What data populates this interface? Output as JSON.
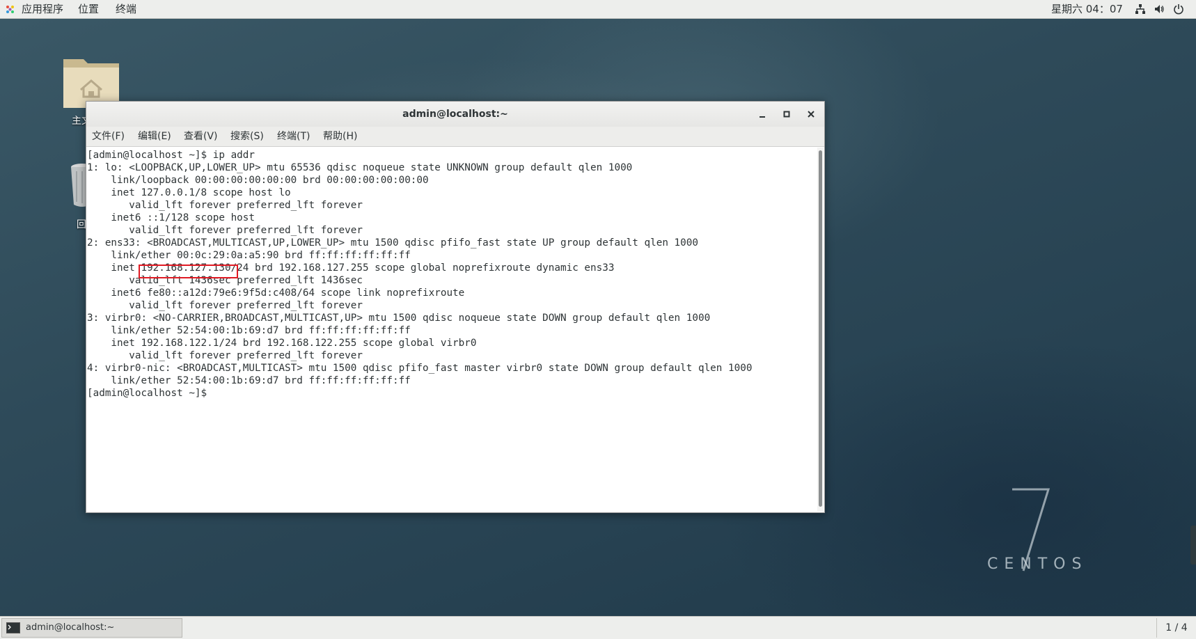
{
  "topbar": {
    "applications": "应用程序",
    "places": "位置",
    "terminal": "终端",
    "clock": "星期六 04：07",
    "icons": [
      "network-icon",
      "volume-icon",
      "power-icon"
    ]
  },
  "desktop": {
    "home_label": "主文",
    "trash_label": "回",
    "os_version": "7",
    "os_name": "CENTOS"
  },
  "window": {
    "title": "admin@localhost:~",
    "menu": [
      "文件(F)",
      "编辑(E)",
      "查看(V)",
      "搜索(S)",
      "终端(T)",
      "帮助(H)"
    ],
    "highlighted_ip": "192.168.127.130",
    "terminal_lines": [
      "[admin@localhost ~]$ ip addr",
      "1: lo: <LOOPBACK,UP,LOWER_UP> mtu 65536 qdisc noqueue state UNKNOWN group default qlen 1000",
      "    link/loopback 00:00:00:00:00:00 brd 00:00:00:00:00:00",
      "    inet 127.0.0.1/8 scope host lo",
      "       valid_lft forever preferred_lft forever",
      "    inet6 ::1/128 scope host",
      "       valid_lft forever preferred_lft forever",
      "2: ens33: <BROADCAST,MULTICAST,UP,LOWER_UP> mtu 1500 qdisc pfifo_fast state UP group default qlen 1000",
      "    link/ether 00:0c:29:0a:a5:90 brd ff:ff:ff:ff:ff:ff",
      "    inet 192.168.127.130/24 brd 192.168.127.255 scope global noprefixroute dynamic ens33",
      "       valid_lft 1436sec preferred_lft 1436sec",
      "    inet6 fe80::a12d:79e6:9f5d:c408/64 scope link noprefixroute",
      "       valid_lft forever preferred_lft forever",
      "3: virbr0: <NO-CARRIER,BROADCAST,MULTICAST,UP> mtu 1500 qdisc noqueue state DOWN group default qlen 1000",
      "    link/ether 52:54:00:1b:69:d7 brd ff:ff:ff:ff:ff:ff",
      "    inet 192.168.122.1/24 brd 192.168.122.255 scope global virbr0",
      "       valid_lft forever preferred_lft forever",
      "4: virbr0-nic: <BROADCAST,MULTICAST> mtu 1500 qdisc pfifo_fast master virbr0 state DOWN group default qlen 1000",
      "    link/ether 52:54:00:1b:69:d7 brd ff:ff:ff:ff:ff:ff",
      "[admin@localhost ~]$ "
    ]
  },
  "taskbar": {
    "window_label": "admin@localhost:~",
    "workspace": "1 / 4"
  },
  "colors": {
    "highlight": "#e01b24",
    "panel": "#edeeec"
  }
}
